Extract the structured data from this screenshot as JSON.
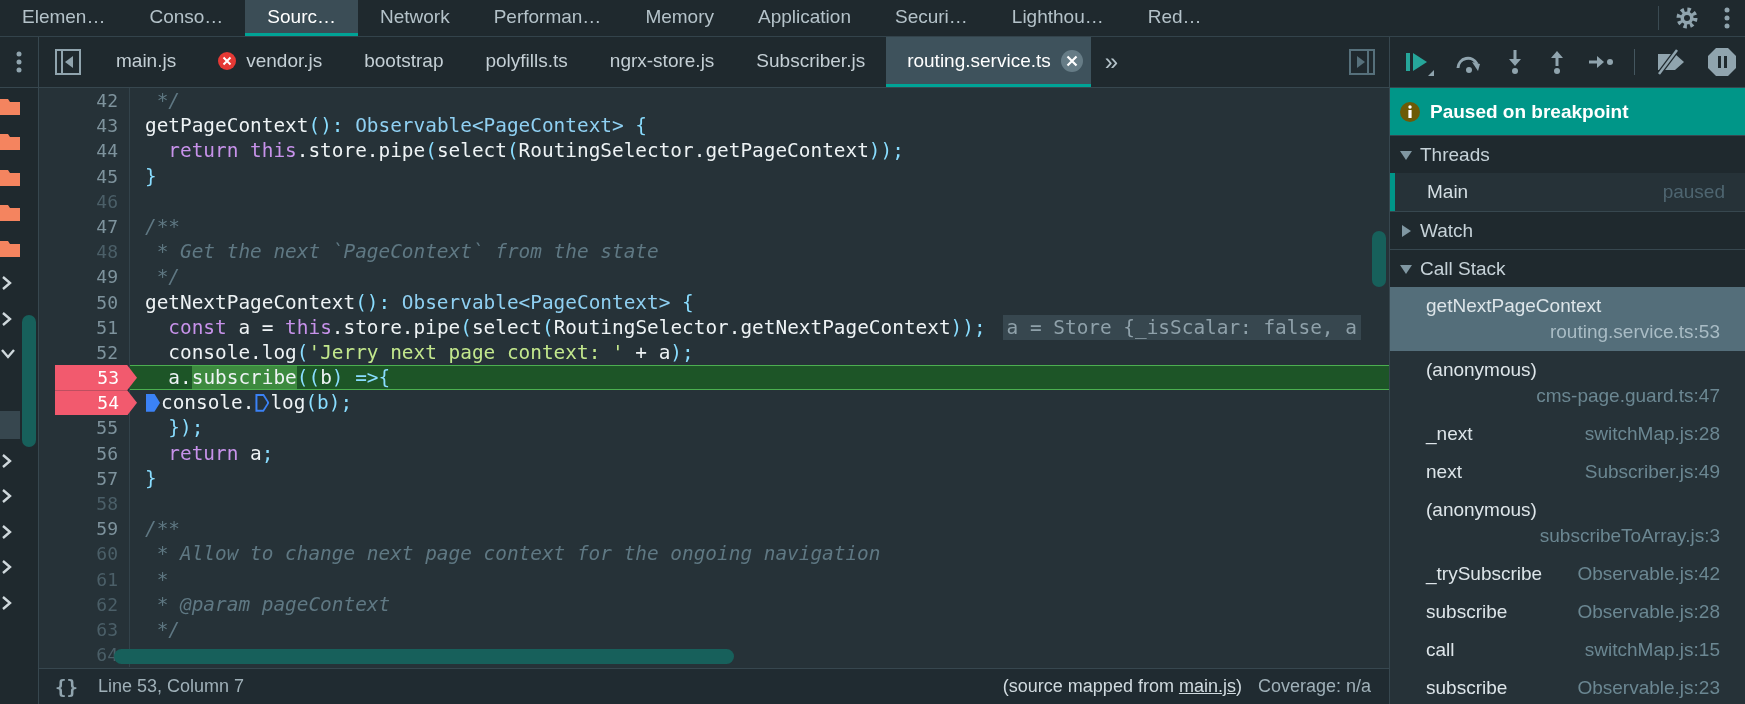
{
  "panel_tabs": [
    {
      "label": "Elemen…",
      "selected": false
    },
    {
      "label": "Conso…",
      "selected": false
    },
    {
      "label": "Sourc…",
      "selected": true
    },
    {
      "label": "Network",
      "selected": false
    },
    {
      "label": "Performan…",
      "selected": false
    },
    {
      "label": "Memory",
      "selected": false
    },
    {
      "label": "Application",
      "selected": false
    },
    {
      "label": "Securi…",
      "selected": false
    },
    {
      "label": "Lighthou…",
      "selected": false
    },
    {
      "label": "Red…",
      "selected": false
    }
  ],
  "navigator_rows": [
    {
      "kind": "folder"
    },
    {
      "kind": "folder"
    },
    {
      "kind": "folder"
    },
    {
      "kind": "folder"
    },
    {
      "kind": "folder"
    },
    {
      "kind": "collapsed"
    },
    {
      "kind": "collapsed"
    },
    {
      "kind": "expanded"
    },
    {
      "kind": "leaf",
      "selected": false
    },
    {
      "kind": "leaf",
      "selected": true
    },
    {
      "kind": "collapsed"
    },
    {
      "kind": "collapsed"
    },
    {
      "kind": "collapsed"
    },
    {
      "kind": "collapsed"
    },
    {
      "kind": "collapsed"
    }
  ],
  "editor": {
    "file_tabs": [
      {
        "label": "main.js",
        "selected": false,
        "error": false
      },
      {
        "label": "vendor.js",
        "selected": false,
        "error": true
      },
      {
        "label": "bootstrap",
        "selected": false,
        "error": false
      },
      {
        "label": "polyfills.ts",
        "selected": false,
        "error": false
      },
      {
        "label": "ngrx-store.js",
        "selected": false,
        "error": false
      },
      {
        "label": "Subscriber.js",
        "selected": false,
        "error": false
      },
      {
        "label": "routing.service.ts",
        "selected": true,
        "error": false
      }
    ],
    "more_tabs": "»",
    "lines": [
      {
        "num": "42",
        "mapped": true,
        "breakpoint": false,
        "current": false,
        "tokens": [
          {
            "kind": "comment",
            "t": " */"
          }
        ]
      },
      {
        "num": "43",
        "mapped": true,
        "breakpoint": false,
        "current": false,
        "tokens": [
          {
            "kind": "plain",
            "t": "getPageContext"
          },
          {
            "kind": "punctuation",
            "t": "():"
          },
          {
            "kind": "type",
            "t": " Observable<PageContext>"
          },
          {
            "kind": "punctuation",
            "t": " {"
          }
        ]
      },
      {
        "num": "44",
        "mapped": true,
        "breakpoint": false,
        "current": false,
        "tokens": [
          {
            "kind": "keyword",
            "t": "  return this"
          },
          {
            "kind": "plain",
            "t": ".store.pipe"
          },
          {
            "kind": "punctuation",
            "t": "("
          },
          {
            "kind": "plain",
            "t": "select"
          },
          {
            "kind": "punctuation",
            "t": "("
          },
          {
            "kind": "plain",
            "t": "RoutingSelector.getPageContext"
          },
          {
            "kind": "punctuation",
            "t": "));"
          }
        ]
      },
      {
        "num": "45",
        "mapped": true,
        "breakpoint": false,
        "current": false,
        "tokens": [
          {
            "kind": "punctuation",
            "t": "}"
          }
        ]
      },
      {
        "num": "46",
        "mapped": false,
        "breakpoint": false,
        "current": false
      },
      {
        "num": "47",
        "mapped": true,
        "breakpoint": false,
        "current": false,
        "tokens": [
          {
            "kind": "comment",
            "t": "/**"
          }
        ]
      },
      {
        "num": "48",
        "mapped": false,
        "breakpoint": false,
        "current": false,
        "tokens": [
          {
            "kind": "comment",
            "t": " * Get the next `PageContext` from the state"
          }
        ]
      },
      {
        "num": "49",
        "mapped": true,
        "breakpoint": false,
        "current": false,
        "tokens": [
          {
            "kind": "comment",
            "t": " */"
          }
        ]
      },
      {
        "num": "50",
        "mapped": true,
        "breakpoint": false,
        "current": false,
        "tokens": [
          {
            "kind": "plain",
            "t": "getNextPageContext"
          },
          {
            "kind": "punctuation",
            "t": "():"
          },
          {
            "kind": "type",
            "t": " Observable<PageContext>"
          },
          {
            "kind": "punctuation",
            "t": " {"
          }
        ]
      },
      {
        "num": "51",
        "mapped": true,
        "breakpoint": false,
        "current": false,
        "tokens": [
          {
            "kind": "keyword",
            "t": "  const "
          },
          {
            "kind": "plain",
            "t": "a = "
          },
          {
            "kind": "keyword",
            "t": "this"
          },
          {
            "kind": "plain",
            "t": ".store.pipe"
          },
          {
            "kind": "punctuation",
            "t": "("
          },
          {
            "kind": "plain",
            "t": "select"
          },
          {
            "kind": "punctuation",
            "t": "("
          },
          {
            "kind": "plain",
            "t": "RoutingSelector.getNextPageContext"
          },
          {
            "kind": "punctuation",
            "t": "));"
          }
        ],
        "inline_value": "a = Store {_isScalar: false, a"
      },
      {
        "num": "52",
        "mapped": true,
        "breakpoint": false,
        "current": false,
        "tokens": [
          {
            "kind": "plain",
            "t": "  console.log"
          },
          {
            "kind": "punctuation",
            "t": "("
          },
          {
            "kind": "string",
            "t": "'Jerry next page context: '"
          },
          {
            "kind": "plain",
            "t": " + a"
          },
          {
            "kind": "punctuation",
            "t": ");"
          }
        ]
      },
      {
        "num": "53",
        "mapped": true,
        "breakpoint": true,
        "current": true,
        "tokens": [
          {
            "kind": "plain",
            "t": "  a."
          },
          {
            "kind": "match",
            "t": "subscribe"
          },
          {
            "kind": "punctuation",
            "t": "(("
          },
          {
            "kind": "plain",
            "t": "b"
          },
          {
            "kind": "punctuation",
            "t": ") =>{"
          }
        ]
      },
      {
        "num": "54",
        "mapped": true,
        "breakpoint": true,
        "current": false,
        "tokens": [
          {
            "kind": "breakpoint",
            "active": true
          },
          {
            "kind": "plain",
            "t": "console."
          },
          {
            "kind": "breakpoint",
            "active": false
          },
          {
            "kind": "plain",
            "t": "log"
          },
          {
            "kind": "punctuation",
            "t": "(b);"
          }
        ]
      },
      {
        "num": "55",
        "mapped": true,
        "breakpoint": false,
        "current": false,
        "tokens": [
          {
            "kind": "punctuation",
            "t": "  });"
          }
        ]
      },
      {
        "num": "56",
        "mapped": true,
        "breakpoint": false,
        "current": false,
        "tokens": [
          {
            "kind": "keyword",
            "t": "  return "
          },
          {
            "kind": "plain",
            "t": "a"
          },
          {
            "kind": "punctuation",
            "t": ";"
          }
        ]
      },
      {
        "num": "57",
        "mapped": true,
        "breakpoint": false,
        "current": false,
        "tokens": [
          {
            "kind": "punctuation",
            "t": "}"
          }
        ]
      },
      {
        "num": "58",
        "mapped": false,
        "breakpoint": false,
        "current": false
      },
      {
        "num": "59",
        "mapped": true,
        "breakpoint": false,
        "current": false,
        "tokens": [
          {
            "kind": "comment",
            "t": "/**"
          }
        ]
      },
      {
        "num": "60",
        "mapped": false,
        "breakpoint": false,
        "current": false,
        "tokens": [
          {
            "kind": "comment",
            "t": " * Allow to change next page context for the ongoing navigation"
          }
        ]
      },
      {
        "num": "61",
        "mapped": false,
        "breakpoint": false,
        "current": false,
        "tokens": [
          {
            "kind": "comment",
            "t": " *"
          }
        ]
      },
      {
        "num": "62",
        "mapped": false,
        "breakpoint": false,
        "current": false,
        "tokens": [
          {
            "kind": "comment",
            "t": " * @param pageContext"
          }
        ]
      },
      {
        "num": "63",
        "mapped": false,
        "breakpoint": false,
        "current": false,
        "tokens": [
          {
            "kind": "comment",
            "t": " */"
          }
        ]
      },
      {
        "num": "64",
        "mapped": false,
        "breakpoint": false,
        "current": false
      }
    ],
    "status": {
      "format_button": "{}",
      "position": "Line 53, Column 7",
      "source_prefix": "(source mapped from ",
      "source_link": "main.js",
      "source_suffix": ")",
      "coverage": "Coverage: n/a"
    }
  },
  "debugger": {
    "banner": "Paused on breakpoint",
    "threads": {
      "title": "Threads",
      "expanded": true,
      "items": [
        {
          "name": "Main",
          "status": "paused",
          "selected": true
        }
      ]
    },
    "watch": {
      "title": "Watch",
      "expanded": false
    },
    "call_stack": {
      "title": "Call Stack",
      "expanded": true,
      "frames": [
        {
          "name": "getNextPageContext",
          "location": "routing.service.ts:53",
          "selected": true
        },
        {
          "name": "(anonymous)",
          "location": "cms-page.guard.ts:47",
          "selected": false
        },
        {
          "name": "_next",
          "location": "switchMap.js:28",
          "selected": false
        },
        {
          "name": "next",
          "location": "Subscriber.js:49",
          "selected": false
        },
        {
          "name": "(anonymous)",
          "location": "subscribeToArray.js:3",
          "selected": false
        },
        {
          "name": "_trySubscribe",
          "location": "Observable.js:42",
          "selected": false
        },
        {
          "name": "subscribe",
          "location": "Observable.js:28",
          "selected": false
        },
        {
          "name": "call",
          "location": "switchMap.js:15",
          "selected": false
        },
        {
          "name": "subscribe",
          "location": "Observable.js:23",
          "selected": false
        }
      ]
    }
  }
}
